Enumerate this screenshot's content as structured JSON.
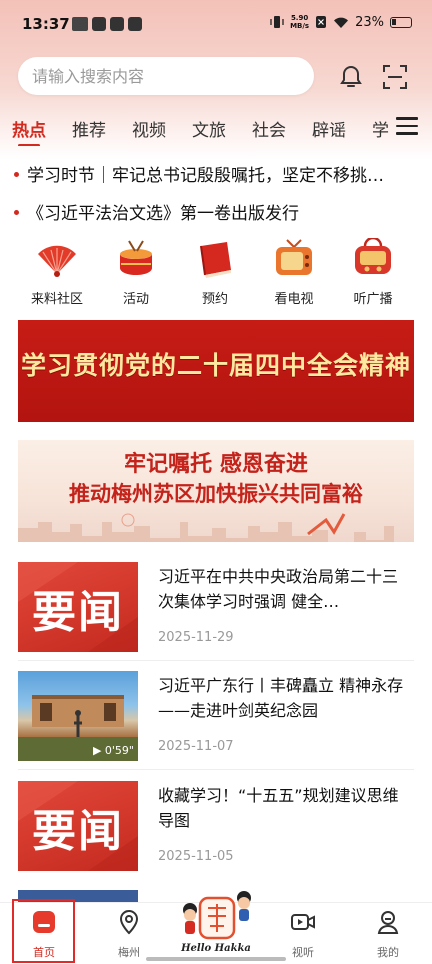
{
  "status_bar": {
    "time": "13:37",
    "speed_value": "5.90",
    "speed_unit": "MB/s",
    "battery": "23%"
  },
  "search": {
    "placeholder": "请输入搜索内容"
  },
  "tabs": [
    {
      "label": "热点",
      "active": true
    },
    {
      "label": "推荐"
    },
    {
      "label": "视频"
    },
    {
      "label": "文旅"
    },
    {
      "label": "社会"
    },
    {
      "label": "辟谣"
    },
    {
      "label": "学"
    }
  ],
  "headlines": [
    "学习时节｜牢记总书记殷殷嘱托，坚定不移挑…",
    "《习近平法治文选》第一卷出版发行"
  ],
  "quick_entries": [
    {
      "label": "来料社区",
      "icon": "fan-icon"
    },
    {
      "label": "活动",
      "icon": "drum-icon"
    },
    {
      "label": "预约",
      "icon": "book-icon"
    },
    {
      "label": "看电视",
      "icon": "tv-icon"
    },
    {
      "label": "听广播",
      "icon": "radio-icon"
    }
  ],
  "banners": {
    "banner1_text": "学习贯彻党的二十届四中全会精神",
    "banner2_line1": "牢记嘱托  感恩奋进",
    "banner2_line2": "推动梅州苏区加快振兴共同富裕"
  },
  "news": [
    {
      "thumb_text": "要闻",
      "title": "习近平在中共中央政治局第二十三次集体学习时强调 健全…",
      "date": "2025-11-29"
    },
    {
      "thumb_text": "",
      "duration": "0'59\"",
      "title": "习近平广东行丨丰碑矗立 精神永存——走进叶剑英纪念园",
      "date": "2025-11-07"
    },
    {
      "thumb_text": "要闻",
      "title": "收藏学习！“十五五”规划建议思维导图",
      "date": "2025-11-05"
    }
  ],
  "bottom_nav": [
    {
      "label": "首页",
      "icon": "home-icon",
      "active": true
    },
    {
      "label": "梅州",
      "icon": "location-pin-icon"
    },
    {
      "label": "Hello Hakka",
      "icon": "hakka-logo"
    },
    {
      "label": "视听",
      "icon": "video-icon"
    },
    {
      "label": "我的",
      "icon": "profile-icon"
    }
  ],
  "colors": {
    "accent": "#d22a1f",
    "banner_red": "#c71c16",
    "banner_gold": "#ffe9a0"
  }
}
